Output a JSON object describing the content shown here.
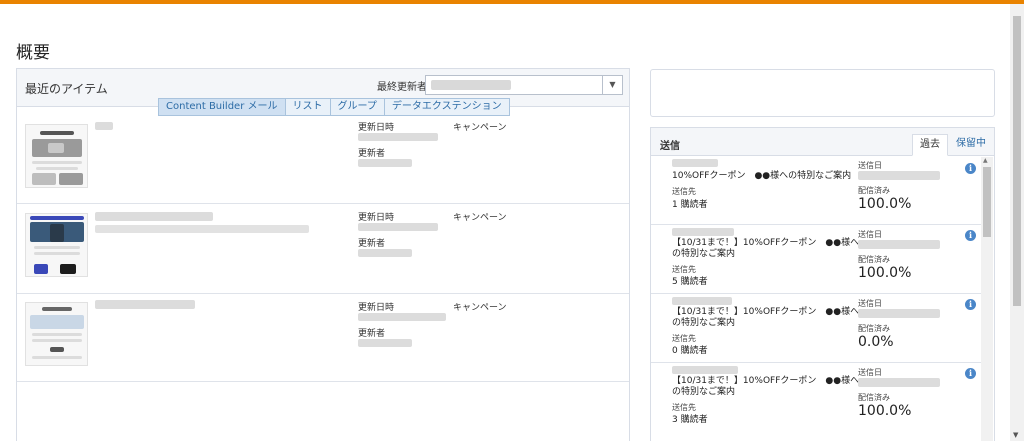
{
  "page": {
    "title": "概要"
  },
  "recent": {
    "title": "最近のアイテム",
    "updater_label": "最終更新者",
    "tabs": [
      "Content Builder メール",
      "リスト",
      "グループ",
      "データエクステンション"
    ],
    "items": [
      {
        "date_label": "更新日時",
        "updater_label": "更新者",
        "type": "キャンペーン"
      },
      {
        "date_label": "更新日時",
        "updater_label": "更新者",
        "type": "キャンペーン"
      },
      {
        "date_label": "更新日時",
        "updater_label": "更新者",
        "type": "キャンペーン"
      }
    ]
  },
  "sends": {
    "title": "送信",
    "tab_past": "過去",
    "tab_pending": "保留中",
    "sent_date_label": "送信日",
    "delivered_label": "配信済み",
    "recipient_label": "送信先",
    "items": [
      {
        "subject": "10%OFFクーポン　●●様への特別なご案内",
        "recipients": "1 購読者",
        "delivered": "100.0%"
      },
      {
        "subject": "【10/31まで！】10%OFFクーポン　●●様への特別なご案内",
        "recipients": "5 購読者",
        "delivered": "100.0%"
      },
      {
        "subject": "【10/31まで！】10%OFFクーポン　●●様への特別なご案内",
        "recipients": "0 購読者",
        "delivered": "0.0%"
      },
      {
        "subject": "【10/31まで！】10%OFFクーポン　●●様への特別なご案内",
        "recipients": "3 購読者",
        "delivered": "100.0%"
      }
    ]
  },
  "colors": {
    "accent": "#e98300",
    "link": "#2d6ca6",
    "info": "#4a86c8"
  },
  "icons": [
    "dropdown-caret-icon",
    "info-icon",
    "scroll-up-icon",
    "scroll-down-icon"
  ]
}
